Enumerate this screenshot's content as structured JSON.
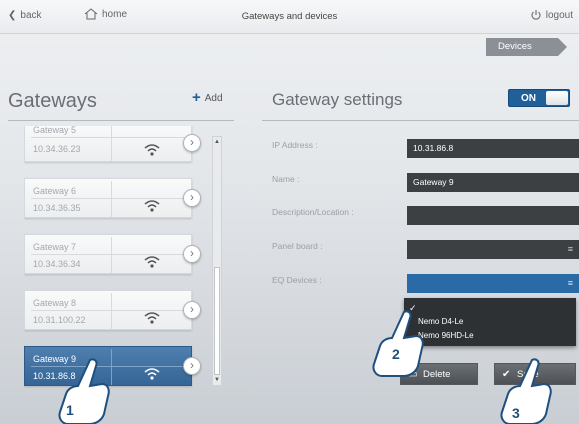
{
  "topbar": {
    "back_label": "back",
    "home_label": "home",
    "title": "Gateways and devices",
    "logout_label": "logout"
  },
  "breadcrumb": {
    "devices_label": "Devices"
  },
  "gateways": {
    "title": "Gateways",
    "add_label": "Add",
    "items": [
      {
        "name": "Gateway 5",
        "ip": "10.34.36.23"
      },
      {
        "name": "Gateway 6",
        "ip": "10.34.36.35"
      },
      {
        "name": "Gateway 7",
        "ip": "10.34.36.34"
      },
      {
        "name": "Gateway 8",
        "ip": "10.31.100.22"
      },
      {
        "name": "Gateway 9",
        "ip": "10.31.86.8"
      }
    ],
    "selected_index": 4
  },
  "settings": {
    "title": "Gateway settings",
    "toggle_label": "ON",
    "fields": {
      "ip_label": "IP Address :",
      "ip_value": "10.31.86.8",
      "name_label": "Name :",
      "name_value": "Gateway 9",
      "description_label": "Description/Location :",
      "description_value": "",
      "panel_label": "Panel board :",
      "panel_value": "",
      "eq_label": "EQ Devices :",
      "eq_value": ""
    },
    "eq_dropdown": {
      "options": [
        "Nemo D4-Le",
        "Nemo 96HD-Le"
      ]
    },
    "delete_label": "Delete",
    "save_label": "Save"
  },
  "callouts": [
    "1",
    "2",
    "3"
  ],
  "colors": {
    "accent": "#2a6aa6",
    "selected_item": "#3f6fa0",
    "field_bg": "#3d4043",
    "callout_text": "#1f4f7c"
  }
}
